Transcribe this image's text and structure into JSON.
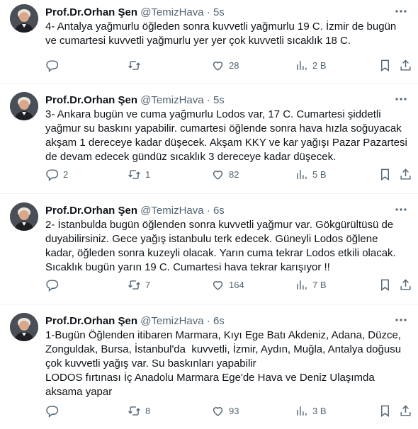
{
  "tweets": [
    {
      "name": "Prof.Dr.Orhan Şen",
      "handle": "@TemizHava",
      "sep": "·",
      "time": "5s",
      "text": "4- Antalya yağmurlu öğleden sonra kuvvetli yağmurlu 19 C. İzmir de bugün ve cumartesi kuvvetli yağmurlu yer yer çok kuvvetli sıcaklık 18 C.",
      "replies": "",
      "retweets": "",
      "likes": "28",
      "views": "2 B"
    },
    {
      "name": "Prof.Dr.Orhan Şen",
      "handle": "@TemizHava",
      "sep": "·",
      "time": "5s",
      "text": "3- Ankara bugün ve cuma yağmurlu Lodos var, 17 C. Cumartesi şiddetli yağmur su baskını yapabilir. cumartesi öğlende sonra hava hızla soğuyacak akşam 1 dereceye kadar düşecek. Akşam KKY ve kar yağışı Pazar Pazartesi de devam edecek gündüz sıcaklık 3 dereceye kadar düşecek.",
      "replies": "2",
      "retweets": "1",
      "likes": "82",
      "views": "5 B"
    },
    {
      "name": "Prof.Dr.Orhan Şen",
      "handle": "@TemizHava",
      "sep": "·",
      "time": "6s",
      "text": "2- İstanbulda bugün öğlenden sonra kuvvetli yağmur var. Gökgürültüsü de duyabilirsiniz. Gece yağış istanbulu terk edecek. Güneyli Lodos öğlene kadar, öğleden sonra kuzeyli olacak. Yarın cuma tekrar Lodos etkili olacak. Sıcaklık bugün yarın 19 C. Cumartesi hava tekrar karışıyor !!",
      "replies": "",
      "retweets": "7",
      "likes": "164",
      "views": "7 B"
    },
    {
      "name": "Prof.Dr.Orhan Şen",
      "handle": "@TemizHava",
      "sep": "·",
      "time": "6s",
      "text": "1-Bugün Öğlenden itibaren Marmara, Kıyı Ege Batı Akdeniz, Adana, Düzce, Zonguldak, Bursa, İstanbul'da  kuvvetli, İzmir, Aydın, Muğla, Antalya doğusu  çok kuvvetli yağış var. Su baskınları yapabilir\nLODOS fırtınası İç Anadolu Marmara Ege'de Hava ve Deniz Ulaşımda aksama yapar",
      "replies": "",
      "retweets": "8",
      "likes": "93",
      "views": "3 B"
    }
  ],
  "icons": {
    "reply": "reply-icon",
    "retweet": "retweet-icon",
    "like": "like-icon",
    "views": "views-icon",
    "bookmark": "bookmark-icon",
    "share": "share-icon",
    "more": "more-icon"
  },
  "colors": {
    "text": "#0f1419",
    "secondary": "#536471",
    "divider": "#eff3f4"
  }
}
